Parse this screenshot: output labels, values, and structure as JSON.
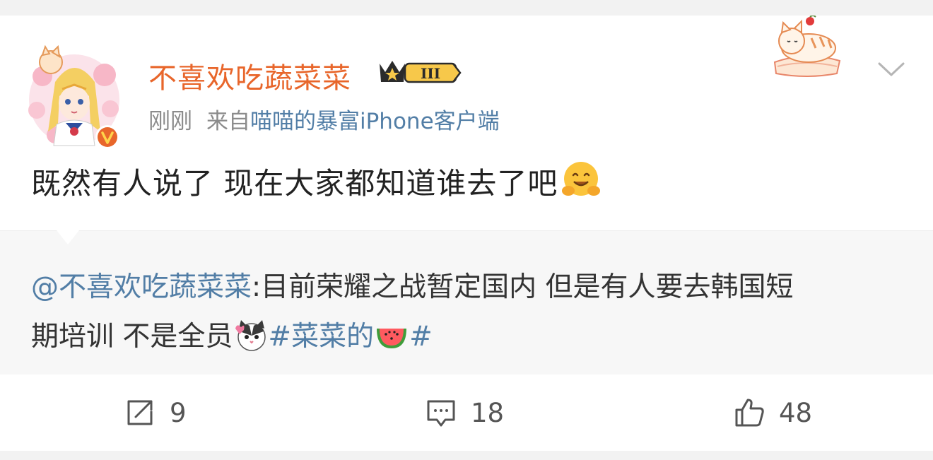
{
  "post": {
    "author": {
      "name": "不喜欢吃蔬菜菜",
      "vip_level": "III",
      "verified": true
    },
    "meta": {
      "time": "刚刚",
      "source_prefix": "来自",
      "source": "喵喵的暴富iPhone客户端"
    },
    "text": "既然有人说了 现在大家都知道谁去了吧",
    "text_emoji": "hugging-face-emoji"
  },
  "repost": {
    "mention": "@不喜欢吃蔬菜菜",
    "line1_text": ":目前荣耀之战暂定国内 但是有人要去韩国短",
    "line2_text": "期培训 不是全员",
    "topic_prefix": "#菜菜的",
    "topic_suffix": "#",
    "emojis": [
      "cat-face-emoji",
      "watermelon-emoji"
    ]
  },
  "actions": {
    "repost_count": "9",
    "comment_count": "18",
    "like_count": "48"
  },
  "colors": {
    "username": "#e8662b",
    "link": "#527ea6",
    "meta_gray": "#8b8b8b",
    "repost_bg": "#f7f7f7"
  }
}
